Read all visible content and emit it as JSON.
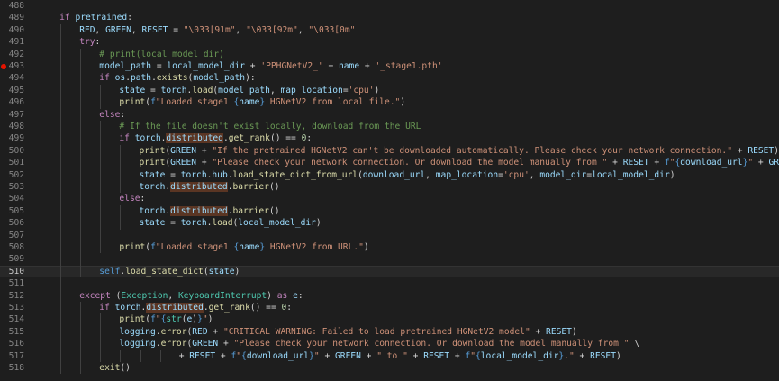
{
  "editor": {
    "current_line": 510,
    "breakpoint_line": 493,
    "lines": [
      {
        "num": 488,
        "indent": 0,
        "tokens": []
      },
      {
        "num": 489,
        "indent": 1,
        "tokens": [
          [
            "kw",
            "if"
          ],
          [
            "pl",
            " "
          ],
          [
            "var",
            "pretrained"
          ],
          [
            "pl",
            ":"
          ]
        ]
      },
      {
        "num": 490,
        "indent": 2,
        "tokens": [
          [
            "var",
            "RED"
          ],
          [
            "pl",
            ", "
          ],
          [
            "var",
            "GREEN"
          ],
          [
            "pl",
            ", "
          ],
          [
            "var",
            "RESET"
          ],
          [
            "pl",
            " = "
          ],
          [
            "str",
            "\"\\033[91m\""
          ],
          [
            "pl",
            ", "
          ],
          [
            "str",
            "\"\\033[92m\""
          ],
          [
            "pl",
            ", "
          ],
          [
            "str",
            "\"\\033[0m\""
          ]
        ]
      },
      {
        "num": 491,
        "indent": 2,
        "tokens": [
          [
            "kw",
            "try"
          ],
          [
            "pl",
            ":"
          ]
        ]
      },
      {
        "num": 492,
        "indent": 3,
        "tokens": [
          [
            "cmt",
            "# print(local_model_dir)"
          ]
        ]
      },
      {
        "num": 493,
        "indent": 3,
        "tokens": [
          [
            "var",
            "model_path"
          ],
          [
            "pl",
            " = "
          ],
          [
            "var",
            "local_model_dir"
          ],
          [
            "pl",
            " + "
          ],
          [
            "str",
            "'PPHGNetV2_'"
          ],
          [
            "pl",
            " + "
          ],
          [
            "var",
            "name"
          ],
          [
            "pl",
            " + "
          ],
          [
            "str",
            "'_stage1.pth'"
          ]
        ]
      },
      {
        "num": 494,
        "indent": 3,
        "tokens": [
          [
            "kw",
            "if"
          ],
          [
            "pl",
            " "
          ],
          [
            "var",
            "os"
          ],
          [
            "pl",
            "."
          ],
          [
            "var",
            "path"
          ],
          [
            "pl",
            "."
          ],
          [
            "fn",
            "exists"
          ],
          [
            "pl",
            "("
          ],
          [
            "var",
            "model_path"
          ],
          [
            "pl",
            "):"
          ]
        ]
      },
      {
        "num": 495,
        "indent": 4,
        "tokens": [
          [
            "var",
            "state"
          ],
          [
            "pl",
            " = "
          ],
          [
            "var",
            "torch"
          ],
          [
            "pl",
            "."
          ],
          [
            "fn",
            "load"
          ],
          [
            "pl",
            "("
          ],
          [
            "var",
            "model_path"
          ],
          [
            "pl",
            ", "
          ],
          [
            "var",
            "map_location"
          ],
          [
            "pl",
            "="
          ],
          [
            "str",
            "'cpu'"
          ],
          [
            "pl",
            ")"
          ]
        ]
      },
      {
        "num": 496,
        "indent": 4,
        "tokens": [
          [
            "fn",
            "print"
          ],
          [
            "pl",
            "("
          ],
          [
            "kw2",
            "f"
          ],
          [
            "str",
            "\"Loaded stage1 "
          ],
          [
            "brace",
            "{"
          ],
          [
            "var",
            "name"
          ],
          [
            "brace",
            "}"
          ],
          [
            "str",
            " HGNetV2 from local file.\""
          ],
          [
            "pl",
            ")"
          ]
        ]
      },
      {
        "num": 497,
        "indent": 3,
        "tokens": [
          [
            "kw",
            "else"
          ],
          [
            "pl",
            ":"
          ]
        ]
      },
      {
        "num": 498,
        "indent": 4,
        "tokens": [
          [
            "cmt",
            "# If the file doesn't exist locally, download from the URL"
          ]
        ]
      },
      {
        "num": 499,
        "indent": 4,
        "tokens": [
          [
            "kw",
            "if"
          ],
          [
            "pl",
            " "
          ],
          [
            "var",
            "torch"
          ],
          [
            "pl",
            "."
          ],
          [
            "dist",
            "distributed"
          ],
          [
            "pl",
            "."
          ],
          [
            "fn",
            "get_rank"
          ],
          [
            "pl",
            "() == "
          ],
          [
            "num",
            "0"
          ],
          [
            "pl",
            ":"
          ]
        ]
      },
      {
        "num": 500,
        "indent": 5,
        "tokens": [
          [
            "fn",
            "print"
          ],
          [
            "pl",
            "("
          ],
          [
            "var",
            "GREEN"
          ],
          [
            "pl",
            " + "
          ],
          [
            "str",
            "\"If the pretrained HGNetV2 can't be downloaded automatically. Please check your network connection.\""
          ],
          [
            "pl",
            " + "
          ],
          [
            "var",
            "RESET"
          ],
          [
            "pl",
            ")"
          ]
        ]
      },
      {
        "num": 501,
        "indent": 5,
        "tokens": [
          [
            "fn",
            "print"
          ],
          [
            "pl",
            "("
          ],
          [
            "var",
            "GREEN"
          ],
          [
            "pl",
            " + "
          ],
          [
            "str",
            "\"Please check your network connection. Or download the model manually from \""
          ],
          [
            "pl",
            " + "
          ],
          [
            "var",
            "RESET"
          ],
          [
            "pl",
            " + "
          ],
          [
            "kw2",
            "f"
          ],
          [
            "str",
            "\""
          ],
          [
            "brace",
            "{"
          ],
          [
            "var",
            "download_url"
          ],
          [
            "brace",
            "}"
          ],
          [
            "str",
            "\""
          ],
          [
            "pl",
            " + "
          ],
          [
            "var",
            "GREEN"
          ]
        ]
      },
      {
        "num": 502,
        "indent": 5,
        "tokens": [
          [
            "var",
            "state"
          ],
          [
            "pl",
            " = "
          ],
          [
            "var",
            "torch"
          ],
          [
            "pl",
            "."
          ],
          [
            "var",
            "hub"
          ],
          [
            "pl",
            "."
          ],
          [
            "fn",
            "load_state_dict_from_url"
          ],
          [
            "pl",
            "("
          ],
          [
            "var",
            "download_url"
          ],
          [
            "pl",
            ", "
          ],
          [
            "var",
            "map_location"
          ],
          [
            "pl",
            "="
          ],
          [
            "str",
            "'cpu'"
          ],
          [
            "pl",
            ", "
          ],
          [
            "var",
            "model_dir"
          ],
          [
            "pl",
            "="
          ],
          [
            "var",
            "local_model_dir"
          ],
          [
            "pl",
            ")"
          ]
        ]
      },
      {
        "num": 503,
        "indent": 5,
        "tokens": [
          [
            "var",
            "torch"
          ],
          [
            "pl",
            "."
          ],
          [
            "dist",
            "distributed"
          ],
          [
            "pl",
            "."
          ],
          [
            "fn",
            "barrier"
          ],
          [
            "pl",
            "()"
          ]
        ]
      },
      {
        "num": 504,
        "indent": 4,
        "tokens": [
          [
            "kw",
            "else"
          ],
          [
            "pl",
            ":"
          ]
        ]
      },
      {
        "num": 505,
        "indent": 5,
        "tokens": [
          [
            "var",
            "torch"
          ],
          [
            "pl",
            "."
          ],
          [
            "dist",
            "distributed"
          ],
          [
            "pl",
            "."
          ],
          [
            "fn",
            "barrier"
          ],
          [
            "pl",
            "()"
          ]
        ]
      },
      {
        "num": 506,
        "indent": 5,
        "tokens": [
          [
            "var",
            "state"
          ],
          [
            "pl",
            " = "
          ],
          [
            "var",
            "torch"
          ],
          [
            "pl",
            "."
          ],
          [
            "fn",
            "load"
          ],
          [
            "pl",
            "("
          ],
          [
            "var",
            "local_model_dir"
          ],
          [
            "pl",
            ")"
          ]
        ]
      },
      {
        "num": 507,
        "indent": 0,
        "tokens": []
      },
      {
        "num": 508,
        "indent": 4,
        "tokens": [
          [
            "fn",
            "print"
          ],
          [
            "pl",
            "("
          ],
          [
            "kw2",
            "f"
          ],
          [
            "str",
            "\"Loaded stage1 "
          ],
          [
            "brace",
            "{"
          ],
          [
            "var",
            "name"
          ],
          [
            "brace",
            "}"
          ],
          [
            "str",
            " HGNetV2 from URL.\""
          ],
          [
            "pl",
            ")"
          ]
        ]
      },
      {
        "num": 509,
        "indent": 0,
        "tokens": []
      },
      {
        "num": 510,
        "indent": 3,
        "tokens": [
          [
            "kw2",
            "self"
          ],
          [
            "pl",
            "."
          ],
          [
            "fn",
            "load_state_dict"
          ],
          [
            "pl",
            "("
          ],
          [
            "var",
            "state"
          ],
          [
            "pl",
            ")"
          ]
        ]
      },
      {
        "num": 511,
        "indent": 0,
        "tokens": []
      },
      {
        "num": 512,
        "indent": 2,
        "tokens": [
          [
            "kw",
            "except"
          ],
          [
            "pl",
            " ("
          ],
          [
            "cls",
            "Exception"
          ],
          [
            "pl",
            ", "
          ],
          [
            "cls",
            "KeyboardInterrupt"
          ],
          [
            "pl",
            ") "
          ],
          [
            "kw",
            "as"
          ],
          [
            "pl",
            " "
          ],
          [
            "var",
            "e"
          ],
          [
            "pl",
            ":"
          ]
        ]
      },
      {
        "num": 513,
        "indent": 3,
        "tokens": [
          [
            "kw",
            "if"
          ],
          [
            "pl",
            " "
          ],
          [
            "var",
            "torch"
          ],
          [
            "pl",
            "."
          ],
          [
            "dist",
            "distributed"
          ],
          [
            "pl",
            "."
          ],
          [
            "fn",
            "get_rank"
          ],
          [
            "pl",
            "() == "
          ],
          [
            "num",
            "0"
          ],
          [
            "pl",
            ":"
          ]
        ]
      },
      {
        "num": 514,
        "indent": 4,
        "tokens": [
          [
            "fn",
            "print"
          ],
          [
            "pl",
            "("
          ],
          [
            "kw2",
            "f"
          ],
          [
            "str",
            "\""
          ],
          [
            "brace",
            "{"
          ],
          [
            "cls",
            "str"
          ],
          [
            "pl",
            "("
          ],
          [
            "var",
            "e"
          ],
          [
            "pl",
            ")"
          ],
          [
            "brace",
            "}"
          ],
          [
            "str",
            "\""
          ],
          [
            "pl",
            ")"
          ]
        ]
      },
      {
        "num": 515,
        "indent": 4,
        "tokens": [
          [
            "var",
            "logging"
          ],
          [
            "pl",
            "."
          ],
          [
            "fn",
            "error"
          ],
          [
            "pl",
            "("
          ],
          [
            "var",
            "RED"
          ],
          [
            "pl",
            " + "
          ],
          [
            "str",
            "\"CRITICAL WARNING: Failed to load pretrained HGNetV2 model\""
          ],
          [
            "pl",
            " + "
          ],
          [
            "var",
            "RESET"
          ],
          [
            "pl",
            ")"
          ]
        ]
      },
      {
        "num": 516,
        "indent": 4,
        "tokens": [
          [
            "var",
            "logging"
          ],
          [
            "pl",
            "."
          ],
          [
            "fn",
            "error"
          ],
          [
            "pl",
            "("
          ],
          [
            "var",
            "GREEN"
          ],
          [
            "pl",
            " + "
          ],
          [
            "str",
            "\"Please check your network connection. Or download the model manually from \""
          ],
          [
            "pl",
            " \\"
          ]
        ]
      },
      {
        "num": 517,
        "indent": 7,
        "tokens": [
          [
            "pl",
            "+ "
          ],
          [
            "var",
            "RESET"
          ],
          [
            "pl",
            " + "
          ],
          [
            "kw2",
            "f"
          ],
          [
            "str",
            "\""
          ],
          [
            "brace",
            "{"
          ],
          [
            "var",
            "download_url"
          ],
          [
            "brace",
            "}"
          ],
          [
            "str",
            "\""
          ],
          [
            "pl",
            " + "
          ],
          [
            "var",
            "GREEN"
          ],
          [
            "pl",
            " + "
          ],
          [
            "str",
            "\" to \""
          ],
          [
            "pl",
            " + "
          ],
          [
            "var",
            "RESET"
          ],
          [
            "pl",
            " + "
          ],
          [
            "kw2",
            "f"
          ],
          [
            "str",
            "\""
          ],
          [
            "brace",
            "{"
          ],
          [
            "var",
            "local_model_dir"
          ],
          [
            "brace",
            "}"
          ],
          [
            "str",
            ".\""
          ],
          [
            "pl",
            " + "
          ],
          [
            "var",
            "RESET"
          ],
          [
            "pl",
            ")"
          ]
        ]
      },
      {
        "num": 518,
        "indent": 3,
        "tokens": [
          [
            "fn",
            "exit"
          ],
          [
            "pl",
            "()"
          ]
        ]
      }
    ]
  }
}
